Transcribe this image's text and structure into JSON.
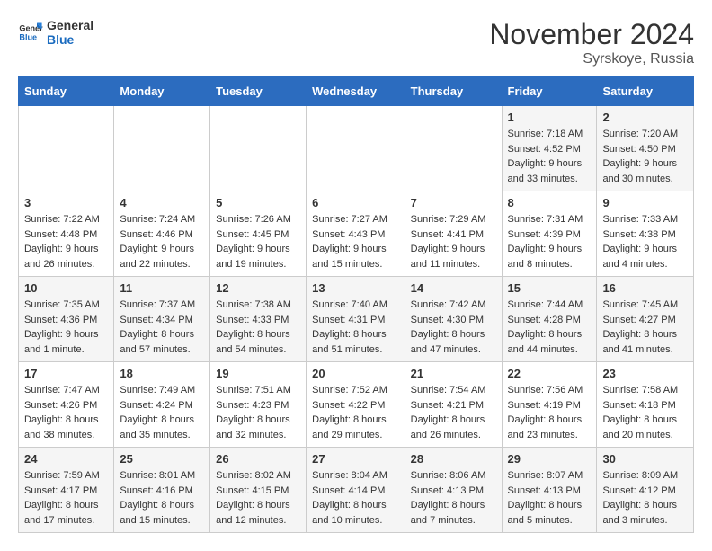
{
  "header": {
    "logo_general": "General",
    "logo_blue": "Blue",
    "month_title": "November 2024",
    "location": "Syrskoye, Russia"
  },
  "weekdays": [
    "Sunday",
    "Monday",
    "Tuesday",
    "Wednesday",
    "Thursday",
    "Friday",
    "Saturday"
  ],
  "weeks": [
    [
      {
        "day": "",
        "sunrise": "",
        "sunset": "",
        "daylight": ""
      },
      {
        "day": "",
        "sunrise": "",
        "sunset": "",
        "daylight": ""
      },
      {
        "day": "",
        "sunrise": "",
        "sunset": "",
        "daylight": ""
      },
      {
        "day": "",
        "sunrise": "",
        "sunset": "",
        "daylight": ""
      },
      {
        "day": "",
        "sunrise": "",
        "sunset": "",
        "daylight": ""
      },
      {
        "day": "1",
        "sunrise": "Sunrise: 7:18 AM",
        "sunset": "Sunset: 4:52 PM",
        "daylight": "Daylight: 9 hours and 33 minutes."
      },
      {
        "day": "2",
        "sunrise": "Sunrise: 7:20 AM",
        "sunset": "Sunset: 4:50 PM",
        "daylight": "Daylight: 9 hours and 30 minutes."
      }
    ],
    [
      {
        "day": "3",
        "sunrise": "Sunrise: 7:22 AM",
        "sunset": "Sunset: 4:48 PM",
        "daylight": "Daylight: 9 hours and 26 minutes."
      },
      {
        "day": "4",
        "sunrise": "Sunrise: 7:24 AM",
        "sunset": "Sunset: 4:46 PM",
        "daylight": "Daylight: 9 hours and 22 minutes."
      },
      {
        "day": "5",
        "sunrise": "Sunrise: 7:26 AM",
        "sunset": "Sunset: 4:45 PM",
        "daylight": "Daylight: 9 hours and 19 minutes."
      },
      {
        "day": "6",
        "sunrise": "Sunrise: 7:27 AM",
        "sunset": "Sunset: 4:43 PM",
        "daylight": "Daylight: 9 hours and 15 minutes."
      },
      {
        "day": "7",
        "sunrise": "Sunrise: 7:29 AM",
        "sunset": "Sunset: 4:41 PM",
        "daylight": "Daylight: 9 hours and 11 minutes."
      },
      {
        "day": "8",
        "sunrise": "Sunrise: 7:31 AM",
        "sunset": "Sunset: 4:39 PM",
        "daylight": "Daylight: 9 hours and 8 minutes."
      },
      {
        "day": "9",
        "sunrise": "Sunrise: 7:33 AM",
        "sunset": "Sunset: 4:38 PM",
        "daylight": "Daylight: 9 hours and 4 minutes."
      }
    ],
    [
      {
        "day": "10",
        "sunrise": "Sunrise: 7:35 AM",
        "sunset": "Sunset: 4:36 PM",
        "daylight": "Daylight: 9 hours and 1 minute."
      },
      {
        "day": "11",
        "sunrise": "Sunrise: 7:37 AM",
        "sunset": "Sunset: 4:34 PM",
        "daylight": "Daylight: 8 hours and 57 minutes."
      },
      {
        "day": "12",
        "sunrise": "Sunrise: 7:38 AM",
        "sunset": "Sunset: 4:33 PM",
        "daylight": "Daylight: 8 hours and 54 minutes."
      },
      {
        "day": "13",
        "sunrise": "Sunrise: 7:40 AM",
        "sunset": "Sunset: 4:31 PM",
        "daylight": "Daylight: 8 hours and 51 minutes."
      },
      {
        "day": "14",
        "sunrise": "Sunrise: 7:42 AM",
        "sunset": "Sunset: 4:30 PM",
        "daylight": "Daylight: 8 hours and 47 minutes."
      },
      {
        "day": "15",
        "sunrise": "Sunrise: 7:44 AM",
        "sunset": "Sunset: 4:28 PM",
        "daylight": "Daylight: 8 hours and 44 minutes."
      },
      {
        "day": "16",
        "sunrise": "Sunrise: 7:45 AM",
        "sunset": "Sunset: 4:27 PM",
        "daylight": "Daylight: 8 hours and 41 minutes."
      }
    ],
    [
      {
        "day": "17",
        "sunrise": "Sunrise: 7:47 AM",
        "sunset": "Sunset: 4:26 PM",
        "daylight": "Daylight: 8 hours and 38 minutes."
      },
      {
        "day": "18",
        "sunrise": "Sunrise: 7:49 AM",
        "sunset": "Sunset: 4:24 PM",
        "daylight": "Daylight: 8 hours and 35 minutes."
      },
      {
        "day": "19",
        "sunrise": "Sunrise: 7:51 AM",
        "sunset": "Sunset: 4:23 PM",
        "daylight": "Daylight: 8 hours and 32 minutes."
      },
      {
        "day": "20",
        "sunrise": "Sunrise: 7:52 AM",
        "sunset": "Sunset: 4:22 PM",
        "daylight": "Daylight: 8 hours and 29 minutes."
      },
      {
        "day": "21",
        "sunrise": "Sunrise: 7:54 AM",
        "sunset": "Sunset: 4:21 PM",
        "daylight": "Daylight: 8 hours and 26 minutes."
      },
      {
        "day": "22",
        "sunrise": "Sunrise: 7:56 AM",
        "sunset": "Sunset: 4:19 PM",
        "daylight": "Daylight: 8 hours and 23 minutes."
      },
      {
        "day": "23",
        "sunrise": "Sunrise: 7:58 AM",
        "sunset": "Sunset: 4:18 PM",
        "daylight": "Daylight: 8 hours and 20 minutes."
      }
    ],
    [
      {
        "day": "24",
        "sunrise": "Sunrise: 7:59 AM",
        "sunset": "Sunset: 4:17 PM",
        "daylight": "Daylight: 8 hours and 17 minutes."
      },
      {
        "day": "25",
        "sunrise": "Sunrise: 8:01 AM",
        "sunset": "Sunset: 4:16 PM",
        "daylight": "Daylight: 8 hours and 15 minutes."
      },
      {
        "day": "26",
        "sunrise": "Sunrise: 8:02 AM",
        "sunset": "Sunset: 4:15 PM",
        "daylight": "Daylight: 8 hours and 12 minutes."
      },
      {
        "day": "27",
        "sunrise": "Sunrise: 8:04 AM",
        "sunset": "Sunset: 4:14 PM",
        "daylight": "Daylight: 8 hours and 10 minutes."
      },
      {
        "day": "28",
        "sunrise": "Sunrise: 8:06 AM",
        "sunset": "Sunset: 4:13 PM",
        "daylight": "Daylight: 8 hours and 7 minutes."
      },
      {
        "day": "29",
        "sunrise": "Sunrise: 8:07 AM",
        "sunset": "Sunset: 4:13 PM",
        "daylight": "Daylight: 8 hours and 5 minutes."
      },
      {
        "day": "30",
        "sunrise": "Sunrise: 8:09 AM",
        "sunset": "Sunset: 4:12 PM",
        "daylight": "Daylight: 8 hours and 3 minutes."
      }
    ]
  ]
}
